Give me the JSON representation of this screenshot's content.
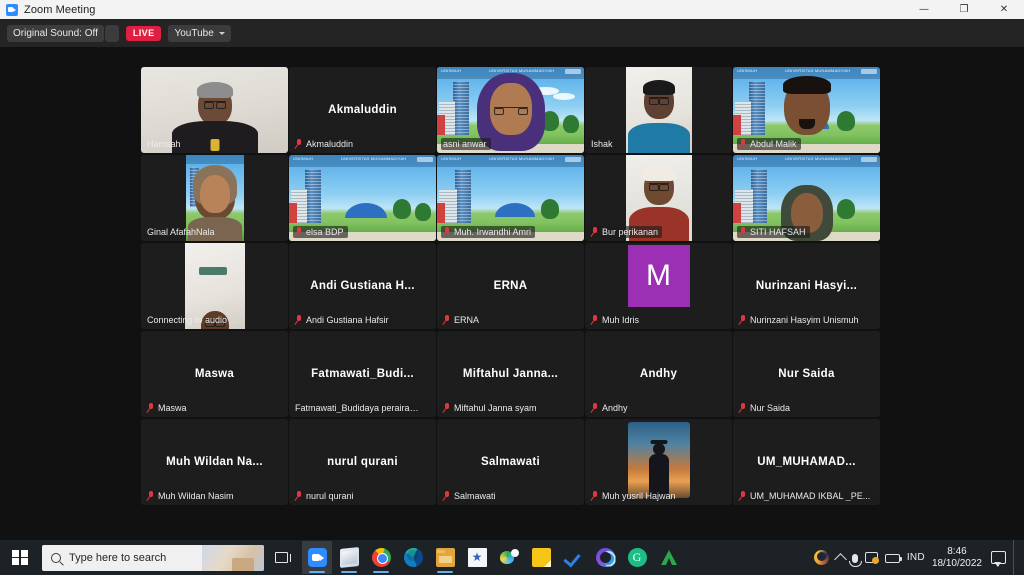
{
  "window": {
    "title": "Zoom Meeting",
    "app_icon": "zoom-video-icon",
    "minimize_label": "—",
    "maximize_label": "❐",
    "close_label": "✕"
  },
  "toolbar": {
    "original_sound_label": "Original Sound: Off",
    "original_sound_caret": "▾",
    "live_label": "LIVE",
    "platform_label": "YouTube",
    "platform_caret": "▾",
    "live_color": "#e02040"
  },
  "meeting": {
    "active_speaker_border_color": "#d8e04a",
    "participants": [
      {
        "name": "Hamsah",
        "display_name": "Hamsah",
        "video": "camera",
        "cam_style": "room-a",
        "muted": false,
        "active": false,
        "big_name": ""
      },
      {
        "name": "Akmaluddin",
        "display_name": "Akmaluddin",
        "video": "none",
        "muted": true,
        "active": false,
        "big_name": "Akmaluddin"
      },
      {
        "name": "asni anwar",
        "display_name": "asni anwar",
        "video": "virtual-bg",
        "muted": false,
        "active": true,
        "big_name": ""
      },
      {
        "name": "Ishak",
        "display_name": "Ishak",
        "video": "camera",
        "cam_style": "room-b",
        "muted": false,
        "active": false,
        "big_name": ""
      },
      {
        "name": "Abdul Malik",
        "display_name": "Abdul Malik",
        "video": "virtual-bg",
        "muted": true,
        "active": false,
        "big_name": ""
      },
      {
        "name": "Ginal AfafahNala",
        "display_name": "Ginal AfafahNala",
        "video": "virtual-bg-portrait",
        "muted": false,
        "active": false,
        "big_name": ""
      },
      {
        "name": "elsa BDP",
        "display_name": "elsa BDP",
        "video": "virtual-bg",
        "muted": true,
        "active": false,
        "big_name": ""
      },
      {
        "name": "Muh. Irwandhi Amri",
        "display_name": "Muh. Irwandhi Amri",
        "video": "virtual-bg",
        "muted": true,
        "active": false,
        "big_name": ""
      },
      {
        "name": "Bur perikanan",
        "display_name": "Bur perikanan",
        "video": "camera",
        "cam_style": "room-c",
        "muted": true,
        "active": false,
        "big_name": ""
      },
      {
        "name": "SITI HAFSAH",
        "display_name": "SITI HAFSAH",
        "video": "virtual-bg",
        "muted": true,
        "active": false,
        "big_name": ""
      },
      {
        "name": "Connecting to audio",
        "display_name": "Connecting to audio ...",
        "video": "camera",
        "cam_style": "room-d",
        "muted": false,
        "active": false,
        "big_name": ""
      },
      {
        "name": "Andi Gustiana Hafsir",
        "display_name": "Andi Gustiana Hafsir",
        "video": "none",
        "muted": true,
        "active": false,
        "big_name": "Andi Gustiana H..."
      },
      {
        "name": "ERNA",
        "display_name": "ERNA",
        "video": "none",
        "muted": true,
        "active": false,
        "big_name": "ERNA"
      },
      {
        "name": "Muh Idris",
        "display_name": "Muh Idris",
        "video": "avatar-initial",
        "avatar_letter": "M",
        "avatar_color": "#9b30b5",
        "muted": true,
        "active": false,
        "big_name": ""
      },
      {
        "name": "Nurinzani Hasyim Unismuh",
        "display_name": "Nurinzani Hasyim Unismuh",
        "video": "none",
        "muted": true,
        "active": false,
        "big_name": "Nurinzani  Hasyi..."
      },
      {
        "name": "Maswa",
        "display_name": "Maswa",
        "video": "none",
        "muted": true,
        "active": false,
        "big_name": "Maswa"
      },
      {
        "name": "Fatmawati_Budidaya perairan",
        "display_name": "Fatmawati_Budidaya perairan ...",
        "video": "none",
        "muted": false,
        "active": false,
        "big_name": "Fatmawati_Budi..."
      },
      {
        "name": "Miftahul Janna syam",
        "display_name": "Miftahul Janna syam",
        "video": "none",
        "muted": true,
        "active": false,
        "big_name": "Miftahul  Janna..."
      },
      {
        "name": "Andhy",
        "display_name": "Andhy",
        "video": "none",
        "muted": true,
        "active": false,
        "big_name": "Andhy"
      },
      {
        "name": "Nur Saida",
        "display_name": "Nur Saida",
        "video": "none",
        "muted": true,
        "active": false,
        "big_name": "Nur Saida"
      },
      {
        "name": "Muh Wildan Nasim",
        "display_name": "Muh Wildan Nasim",
        "video": "none",
        "muted": true,
        "active": false,
        "big_name": "Muh Wildan Na..."
      },
      {
        "name": "nurul qurani",
        "display_name": "nurul qurani",
        "video": "none",
        "muted": true,
        "active": false,
        "big_name": "nurul qurani"
      },
      {
        "name": "Salmawati",
        "display_name": "Salmawati",
        "video": "none",
        "muted": true,
        "active": false,
        "big_name": "Salmawati"
      },
      {
        "name": "Muh yusril Hajwan",
        "display_name": "Muh yusril Hajwan",
        "video": "avatar-photo",
        "muted": true,
        "active": false,
        "big_name": ""
      },
      {
        "name": "UM_MUHAMAD IKBAL _PE",
        "display_name": "UM_MUHAMAD IKBAL _PE...",
        "video": "none",
        "muted": true,
        "active": false,
        "big_name": "UM_MUHAMAD..."
      }
    ],
    "virtual_background_header": "UNIVERSITAS MUHAMMADIYAH MAKASSAR"
  },
  "taskbar": {
    "start_label": "start-button",
    "search_placeholder": "Type here to search",
    "task_view_label": "Task View",
    "apps": [
      {
        "name": "zoom",
        "icon": "zoom-icon",
        "running": true,
        "active": true
      },
      {
        "name": "word",
        "icon": "word-icon",
        "running": true,
        "active": false
      },
      {
        "name": "chrome",
        "icon": "chrome-icon",
        "running": true,
        "active": false
      },
      {
        "name": "edge",
        "icon": "edge-icon",
        "running": false,
        "active": false
      },
      {
        "name": "file-explorer",
        "icon": "folder-icon",
        "running": true,
        "active": false
      },
      {
        "name": "store",
        "icon": "star-icon",
        "running": false,
        "active": false
      },
      {
        "name": "paint",
        "icon": "paint-icon",
        "running": false,
        "active": false
      },
      {
        "name": "sticky-notes",
        "icon": "notes-icon",
        "running": false,
        "active": false
      },
      {
        "name": "todo",
        "icon": "check-icon",
        "running": false,
        "active": false
      },
      {
        "name": "cortana",
        "icon": "cortana-icon",
        "running": false,
        "active": false
      },
      {
        "name": "grammarly",
        "icon": "grammarly-icon",
        "running": false,
        "active": false
      },
      {
        "name": "anydesk",
        "icon": "anydesk-icon",
        "running": false,
        "active": false
      }
    ],
    "tray": {
      "firefox_icon": "firefox-icon",
      "overflow_icon": "chevron-up-icon",
      "mic_icon": "microphone-icon",
      "pictures_icon": "onedrive-photos-icon",
      "battery_icon": "battery-icon",
      "language": "IND",
      "time": "8:46",
      "date": "18/10/2022",
      "action_center_icon": "notifications-icon"
    }
  }
}
